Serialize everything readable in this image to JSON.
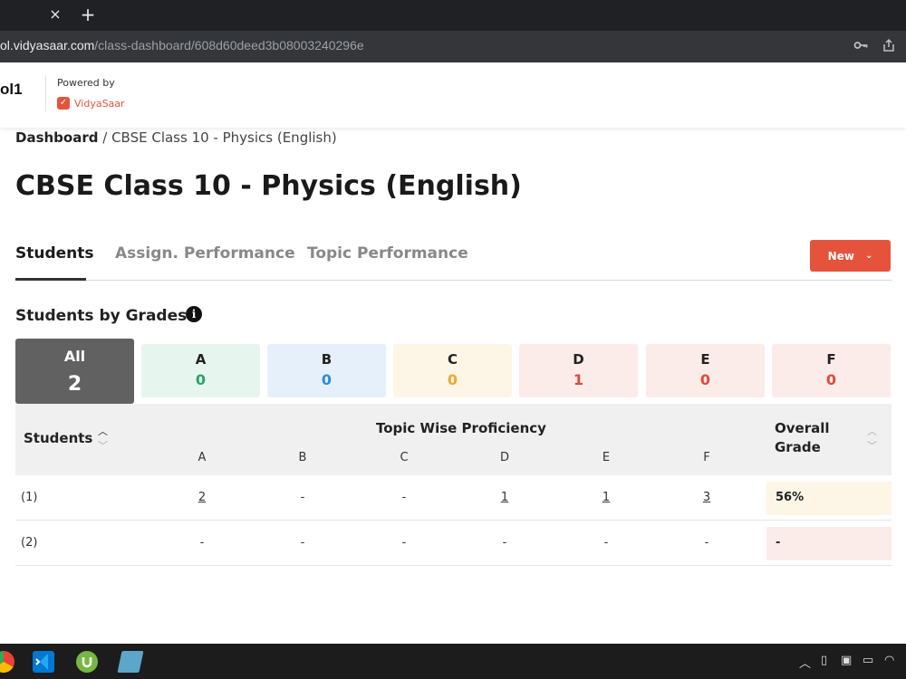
{
  "browser": {
    "url_host": "ol.vidyasaar.com",
    "url_path": "/class-dashboard/608d60deed3b08003240296e",
    "tab_close_label": "×",
    "new_tab_label": "+"
  },
  "header": {
    "school_name": "ol1",
    "powered_by": "Powered by",
    "brand_name": "VidyaSaar"
  },
  "breadcrumb": {
    "home": "Dashboard",
    "separator": " / ",
    "current": "CBSE Class 10 - Physics (English)"
  },
  "page_title": "CBSE Class 10 - Physics (English)",
  "tabs": [
    {
      "label": "Students",
      "active": true
    },
    {
      "label": "Assign. Performance",
      "active": false
    },
    {
      "label": "Topic Performance",
      "active": false
    }
  ],
  "new_button": {
    "label": "New"
  },
  "grades_section": {
    "title": "Students by Grades",
    "all": {
      "label": "All",
      "count": "2"
    },
    "cards": [
      {
        "label": "A",
        "count": "0",
        "bg": "#e6f6ef",
        "color": "#2ba36b"
      },
      {
        "label": "B",
        "count": "0",
        "bg": "#e6f0fb",
        "color": "#2d8ae0"
      },
      {
        "label": "C",
        "count": "0",
        "bg": "#fdf5e6",
        "color": "#f0a830"
      },
      {
        "label": "D",
        "count": "1",
        "bg": "#fbece9",
        "color": "#e0493a"
      },
      {
        "label": "E",
        "count": "0",
        "bg": "#fbece9",
        "color": "#e0493a"
      },
      {
        "label": "F",
        "count": "0",
        "bg": "#fbece9",
        "color": "#e0493a"
      }
    ]
  },
  "table": {
    "students_header": "Students",
    "topic_header": "Topic Wise Proficiency",
    "columns": [
      "A",
      "B",
      "C",
      "D",
      "E",
      "F"
    ],
    "overall_header_line1": "Overall",
    "overall_header_line2": "Grade",
    "rows": [
      {
        "name": "(1)",
        "cells": [
          "2",
          "-",
          "-",
          "1",
          "1",
          "3"
        ],
        "overall": "56%",
        "overall_bg": "#fdf5e6"
      },
      {
        "name": "(2)",
        "cells": [
          "-",
          "-",
          "-",
          "-",
          "-",
          "-"
        ],
        "overall": "-",
        "overall_bg": "#fbece9"
      }
    ]
  },
  "taskbar": {
    "icons": [
      "chrome-icon",
      "vscode-icon",
      "utorrent-icon",
      "notepad-icon"
    ]
  }
}
